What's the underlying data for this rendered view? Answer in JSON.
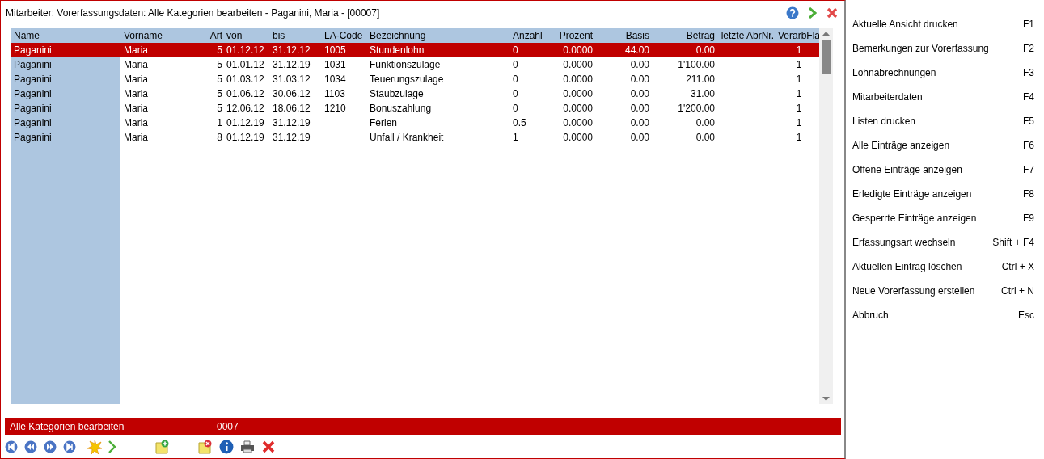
{
  "window": {
    "title": "Mitarbeiter: Vorerfassungsdaten: Alle Kategorien bearbeiten - Paganini, Maria  -  [00007]"
  },
  "table": {
    "columns": [
      "Name",
      "Vorname",
      "Art",
      "von",
      "bis",
      "LA-Code",
      "Bezeichnung",
      "Anzahl",
      "Prozent",
      "Basis",
      "Betrag",
      "letzte AbrNr.",
      "VerarbFla"
    ],
    "rows": [
      {
        "selected": true,
        "cells": [
          "Paganini",
          "Maria",
          "5",
          "01.12.12",
          "31.12.12",
          "1005",
          "Stundenlohn",
          "0",
          "0.0000",
          "44.00",
          "0.00",
          "",
          "1"
        ]
      },
      {
        "selected": false,
        "cells": [
          "Paganini",
          "Maria",
          "5",
          "01.01.12",
          "31.12.19",
          "1031",
          "Funktionszulage",
          "0",
          "0.0000",
          "0.00",
          "1'100.00",
          "",
          "1"
        ]
      },
      {
        "selected": false,
        "cells": [
          "Paganini",
          "Maria",
          "5",
          "01.03.12",
          "31.03.12",
          "1034",
          "Teuerungszulage",
          "0",
          "0.0000",
          "0.00",
          "211.00",
          "",
          "1"
        ]
      },
      {
        "selected": false,
        "cells": [
          "Paganini",
          "Maria",
          "5",
          "01.06.12",
          "30.06.12",
          "1103",
          "Staubzulage",
          "0",
          "0.0000",
          "0.00",
          "31.00",
          "",
          "1"
        ]
      },
      {
        "selected": false,
        "cells": [
          "Paganini",
          "Maria",
          "5",
          "12.06.12",
          "18.06.12",
          "1210",
          "Bonuszahlung",
          "0",
          "0.0000",
          "0.00",
          "1'200.00",
          "",
          "1"
        ]
      },
      {
        "selected": false,
        "cells": [
          "Paganini",
          "Maria",
          "1",
          "01.12.19",
          "31.12.19",
          "",
          "Ferien",
          "0.5",
          "0.0000",
          "0.00",
          "0.00",
          "",
          "1"
        ]
      },
      {
        "selected": false,
        "cells": [
          "Paganini",
          "Maria",
          "8",
          "01.12.19",
          "31.12.19",
          "",
          "Unfall / Krankheit",
          "1",
          "0.0000",
          "0.00",
          "0.00",
          "",
          "1"
        ]
      }
    ]
  },
  "status_bar": {
    "label": "Alle Kategorien bearbeiten",
    "code": "0007"
  },
  "menu": [
    {
      "label": "Aktuelle Ansicht drucken",
      "shortcut": "F1"
    },
    {
      "label": "Bemerkungen zur Vorerfassung",
      "shortcut": "F2"
    },
    {
      "label": "Lohnabrechnungen",
      "shortcut": "F3"
    },
    {
      "label": "Mitarbeiterdaten",
      "shortcut": "F4"
    },
    {
      "label": "Listen drucken",
      "shortcut": "F5"
    },
    {
      "label": "Alle Einträge anzeigen",
      "shortcut": "F6"
    },
    {
      "label": "Offene Einträge anzeigen",
      "shortcut": "F7"
    },
    {
      "label": "Erledigte Einträge anzeigen",
      "shortcut": "F8"
    },
    {
      "label": "Gesperrte Einträge anzeigen",
      "shortcut": "F9"
    },
    {
      "label": "Erfassungsart wechseln",
      "shortcut": "Shift + F4"
    },
    {
      "label": "Aktuellen Eintrag löschen",
      "shortcut": "Ctrl + X"
    },
    {
      "label": "Neue Vorerfassung erstellen",
      "shortcut": "Ctrl + N"
    },
    {
      "label": "Abbruch",
      "shortcut": "Esc"
    }
  ]
}
